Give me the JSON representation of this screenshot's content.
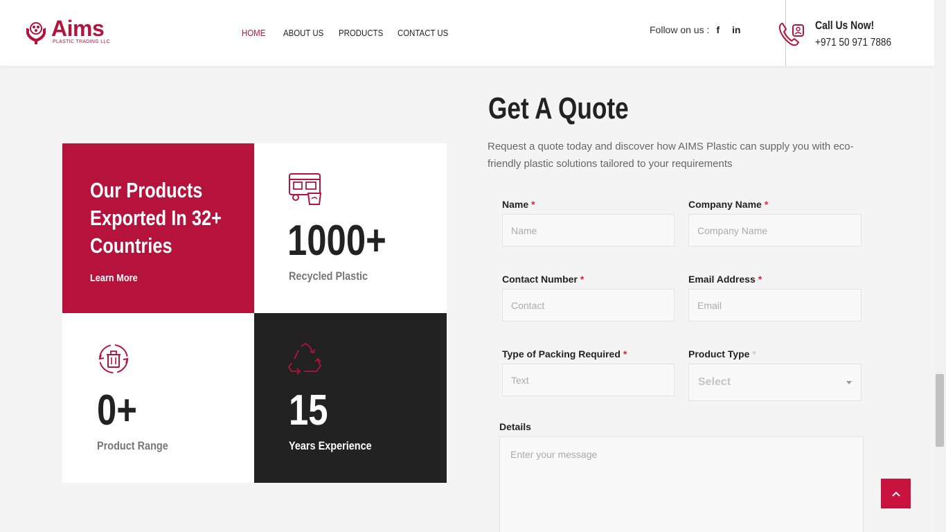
{
  "brand": {
    "name": "Aims",
    "tagline": "PLASTIC TRADING LLC",
    "accent": "#b5123c",
    "dark": "#222222"
  },
  "nav": {
    "items": [
      {
        "label": "HOME",
        "active": true
      },
      {
        "label": "ABOUT US",
        "active": false
      },
      {
        "label": "PRODUCTS",
        "active": false
      },
      {
        "label": "CONTACT US",
        "active": false
      }
    ]
  },
  "follow": {
    "label": "Follow on us :",
    "facebook_glyph": "f",
    "linkedin_glyph": "in"
  },
  "call": {
    "title": "Call Us Now!",
    "phone": "+971 50 971 7886"
  },
  "promo": {
    "title_lines": [
      "Our Products",
      "Exported In 32+",
      "Countries"
    ],
    "link": "Learn More"
  },
  "stats": [
    {
      "number": "1000+",
      "label": "Recycled Plastic",
      "icon": "truck-icon"
    },
    {
      "number": "0+",
      "label": "Product Range",
      "icon": "recycle-bin-icon"
    },
    {
      "number": "15",
      "label": "Years Experience",
      "icon": "recycle-icon"
    }
  ],
  "quote": {
    "title": "Get A Quote",
    "description": "Request a quote today and discover how AIMS Plastic can supply you with eco-friendly plastic solutions tailored to your requirements",
    "fields": {
      "name": {
        "label": "Name",
        "required_mark": "*",
        "placeholder": "Name"
      },
      "company": {
        "label": "Company Name",
        "required_mark": "*",
        "placeholder": "Company Name"
      },
      "contact": {
        "label": "Contact Number",
        "required_mark": "*",
        "placeholder": "Contact"
      },
      "email": {
        "label": "Email Address",
        "required_mark": "*",
        "placeholder": "Email"
      },
      "packing": {
        "label": "Type of Packing Required",
        "required_mark": "*",
        "placeholder": "Text"
      },
      "product_type": {
        "label": "Product Type",
        "required_mark": "*",
        "selected": "Select"
      },
      "details": {
        "label": "Details",
        "placeholder": "Enter your message"
      }
    }
  }
}
